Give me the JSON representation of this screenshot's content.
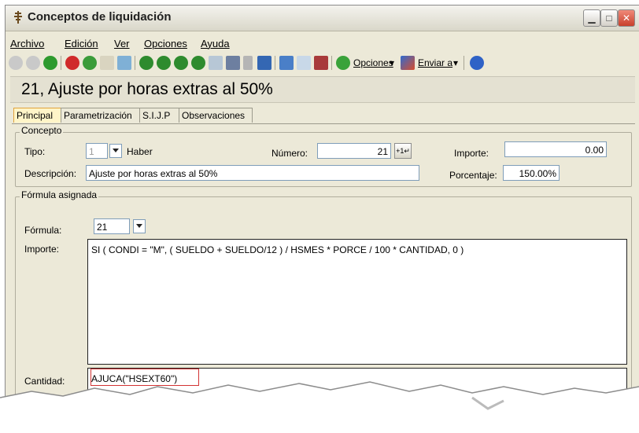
{
  "window": {
    "title": "Conceptos de liquidación"
  },
  "menu": [
    "Archivo",
    "Edición",
    "Ver",
    "Opciones",
    "Ayuda"
  ],
  "toolbar": {
    "opciones_label": "Opciones",
    "enviar_label": "Enviar a"
  },
  "heading": "21, Ajuste por horas extras al 50%",
  "tabs": [
    "Principal",
    "Parametrización",
    "S.I.J.P",
    "Observaciones"
  ],
  "concepto": {
    "group_label": "Concepto",
    "tipo_label": "Tipo:",
    "tipo_value": "1",
    "tipo_text": "Haber",
    "numero_label": "Número:",
    "numero_value": "21",
    "importe_label": "Importe:",
    "importe_value": "0.00",
    "descripcion_label": "Descripción:",
    "descripcion_value": "Ajuste por horas extras al 50%",
    "porcentaje_label": "Porcentaje:",
    "porcentaje_value": "150.00%"
  },
  "formula": {
    "group_label": "Fórmula asignada",
    "formula_label": "Fórmula:",
    "formula_value": "21",
    "importe_label": "Importe:",
    "importe_expr": "SI ( CONDI = \"M\", ( SUELDO + SUELDO/12 ) / HSMES * PORCE / 100 * CANTIDAD, 0 )",
    "cantidad_label": "Cantidad:",
    "cantidad_expr": "AJUCA(\"HSEXT60\")"
  },
  "colors": {
    "highlight": "#d23333",
    "active_tab": "#fff5c8"
  }
}
